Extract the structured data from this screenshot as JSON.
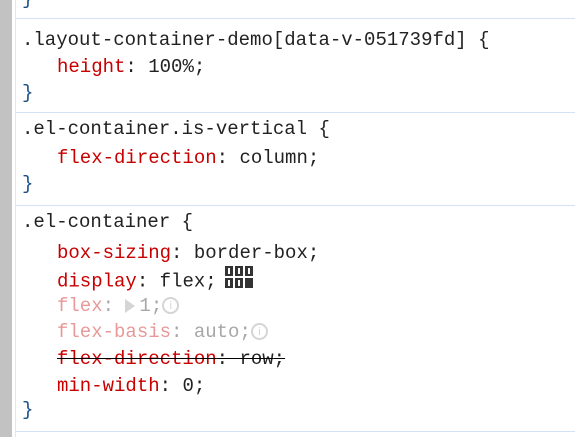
{
  "rules": [
    {
      "selector": ".layout-container-demo[data-v-051739fd]",
      "open": " {",
      "close": "}",
      "props": [
        {
          "name": "height",
          "value": "100%"
        }
      ]
    },
    {
      "selector": ".el-container.is-vertical",
      "open": " {",
      "close": "}",
      "props": [
        {
          "name": "flex-direction",
          "value": "column"
        }
      ]
    },
    {
      "selector": ".el-container",
      "open": " {",
      "close": "}",
      "props": [
        {
          "name": "box-sizing",
          "value": "border-box"
        },
        {
          "name": "display",
          "value": "flex"
        },
        {
          "name": "flex",
          "value": "1"
        },
        {
          "name": "flex-basis",
          "value": "auto"
        },
        {
          "name": "flex-direction",
          "value": "row"
        },
        {
          "name": "min-width",
          "value": "0"
        }
      ]
    }
  ],
  "top_brace": "}",
  "icons": {
    "flex_editor": "flexbox-editor-icon",
    "info": "info-icon",
    "expand": "expand-triangle-icon"
  },
  "colors": {
    "property": "#c80000",
    "brace": "#1a4f8a",
    "separator": "#d3e0f5"
  }
}
